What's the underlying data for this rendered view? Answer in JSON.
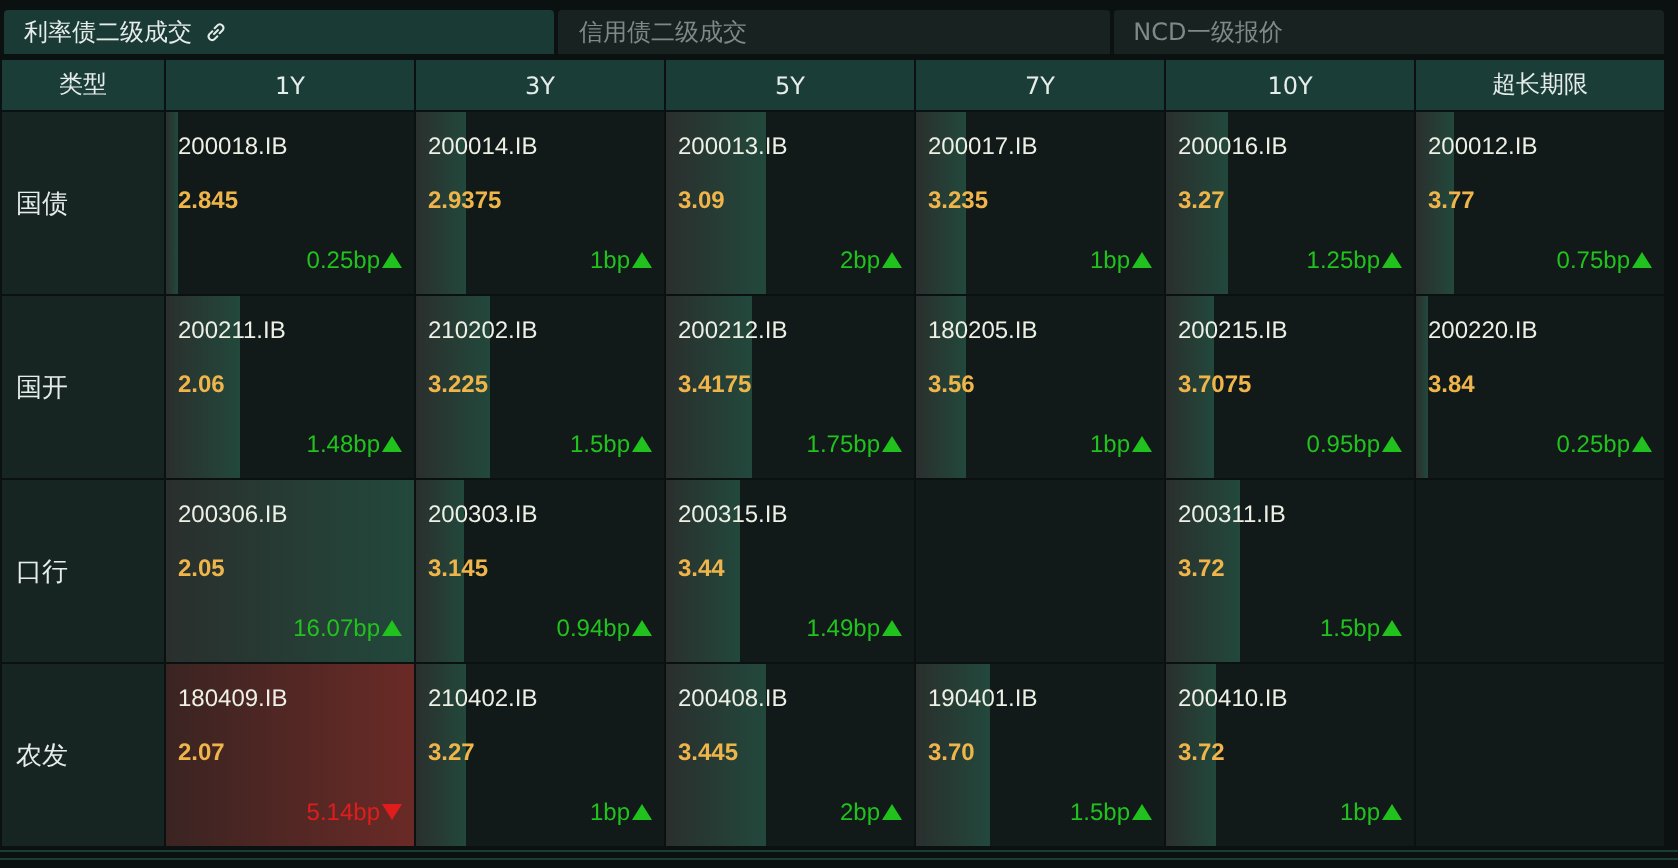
{
  "tabs": [
    {
      "label": "利率债二级成交",
      "selected": true,
      "link": true
    },
    {
      "label": "信用债二级成交",
      "selected": false,
      "link": false
    },
    {
      "label": "NCD一级报价",
      "selected": false,
      "link": false
    }
  ],
  "table": {
    "type_header": "类型",
    "columns": [
      "1Y",
      "3Y",
      "5Y",
      "7Y",
      "10Y",
      "超长期限"
    ],
    "rows": [
      {
        "type": "国债",
        "cells": [
          {
            "kind": "quote",
            "code": "200018.IB",
            "yield": "2.845",
            "change": "0.25bp",
            "rising": true,
            "level": 0.05
          },
          {
            "kind": "quote",
            "code": "200014.IB",
            "yield": "2.9375",
            "change": "1bp",
            "rising": true,
            "level": 0.2
          },
          {
            "kind": "quote",
            "code": "200013.IB",
            "yield": "3.09",
            "change": "2bp",
            "rising": true,
            "level": 0.4
          },
          {
            "kind": "quote",
            "code": "200017.IB",
            "yield": "3.235",
            "change": "1bp",
            "rising": true,
            "level": 0.2
          },
          {
            "kind": "quote",
            "code": "200016.IB",
            "yield": "3.27",
            "change": "1.25bp",
            "rising": true,
            "level": 0.25
          },
          {
            "kind": "quote",
            "code": "200012.IB",
            "yield": "3.77",
            "change": "0.75bp",
            "rising": true,
            "level": 0.15
          }
        ]
      },
      {
        "type": "国开",
        "cells": [
          {
            "kind": "quote",
            "code": "200211.IB",
            "yield": "2.06",
            "change": "1.48bp",
            "rising": true,
            "level": 0.3
          },
          {
            "kind": "quote",
            "code": "210202.IB",
            "yield": "3.225",
            "change": "1.5bp",
            "rising": true,
            "level": 0.3
          },
          {
            "kind": "quote",
            "code": "200212.IB",
            "yield": "3.4175",
            "change": "1.75bp",
            "rising": true,
            "level": 0.35
          },
          {
            "kind": "quote",
            "code": "180205.IB",
            "yield": "3.56",
            "change": "1bp",
            "rising": true,
            "level": 0.2
          },
          {
            "kind": "quote",
            "code": "200215.IB",
            "yield": "3.7075",
            "change": "0.95bp",
            "rising": true,
            "level": 0.19
          },
          {
            "kind": "quote",
            "code": "200220.IB",
            "yield": "3.84",
            "change": "0.25bp",
            "rising": true,
            "level": 0.05
          }
        ]
      },
      {
        "type": "口行",
        "cells": [
          {
            "kind": "quote",
            "code": "200306.IB",
            "yield": "2.05",
            "change": "16.07bp",
            "rising": true,
            "level": 1
          },
          {
            "kind": "quote",
            "code": "200303.IB",
            "yield": "3.145",
            "change": "0.94bp",
            "rising": true,
            "level": 0.19
          },
          {
            "kind": "quote",
            "code": "200315.IB",
            "yield": "3.44",
            "change": "1.49bp",
            "rising": true,
            "level": 0.3
          },
          {
            "kind": "empty"
          },
          {
            "kind": "quote",
            "code": "200311.IB",
            "yield": "3.72",
            "change": "1.5bp",
            "rising": true,
            "level": 0.3
          },
          {
            "kind": "empty"
          }
        ]
      },
      {
        "type": "农发",
        "cells": [
          {
            "kind": "quote",
            "code": "180409.IB",
            "yield": "2.07",
            "change": "5.14bp",
            "rising": false,
            "level": 1
          },
          {
            "kind": "quote",
            "code": "210402.IB",
            "yield": "3.27",
            "change": "1bp",
            "rising": true,
            "level": 0.2
          },
          {
            "kind": "quote",
            "code": "200408.IB",
            "yield": "3.445",
            "change": "2bp",
            "rising": true,
            "level": 0.4
          },
          {
            "kind": "quote",
            "code": "190401.IB",
            "yield": "3.70",
            "change": "1.5bp",
            "rising": true,
            "level": 0.3
          },
          {
            "kind": "quote",
            "code": "200410.IB",
            "yield": "3.72",
            "change": "1bp",
            "rising": true,
            "level": 0.2
          },
          {
            "kind": "empty"
          }
        ]
      }
    ]
  }
}
